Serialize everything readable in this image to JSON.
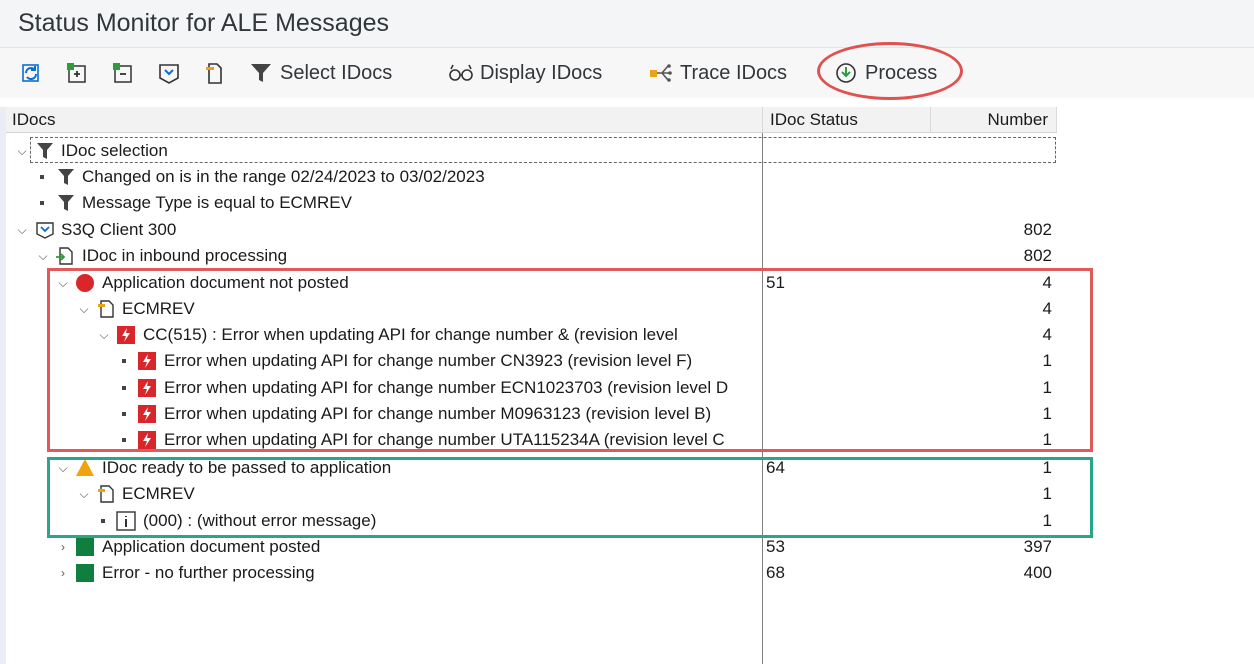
{
  "title": "Status Monitor for ALE Messages",
  "toolbar": {
    "icons": [
      "refresh-icon",
      "expand-icon",
      "collapse-icon",
      "idoc-icon",
      "message-type-icon"
    ],
    "select_label": "Select IDocs",
    "display_label": "Display IDocs",
    "trace_label": "Trace IDocs",
    "process_label": "Process"
  },
  "columns": {
    "idocs": "IDocs",
    "status": "IDoc Status",
    "number": "Number"
  },
  "tree": {
    "selection": {
      "label": "IDoc selection"
    },
    "filter1": {
      "label": "Changed on is in the range 02/24/2023 to 03/02/2023"
    },
    "filter2": {
      "label": "Message Type is equal to ECMREV"
    },
    "client": {
      "label": "S3Q Client 300",
      "number": "802"
    },
    "inbound": {
      "label": "IDoc in inbound processing",
      "number": "802"
    },
    "not_posted": {
      "label": "Application document not posted",
      "status": "51",
      "number": "4"
    },
    "ecmrev1": {
      "label": "ECMREV",
      "number": "4"
    },
    "cc515": {
      "label": "CC(515) : Error when updating API for change number & (revision level",
      "number": "4"
    },
    "err1": {
      "label": "Error when updating API for change number CN3923 (revision level F)",
      "number": "1"
    },
    "err2": {
      "label": "Error when updating API for change number ECN1023703 (revision level D",
      "number": "1"
    },
    "err3": {
      "label": "Error when updating API for change number M0963123 (revision level B)",
      "number": "1"
    },
    "err4": {
      "label": "Error when updating API for change number UTA115234A (revision level C",
      "number": "1"
    },
    "ready": {
      "label": "IDoc ready to be passed to application",
      "status": "64",
      "number": "1"
    },
    "ecmrev2": {
      "label": "ECMREV",
      "number": "1"
    },
    "info000": {
      "label": "(000) : (without error message)",
      "number": "1"
    },
    "posted": {
      "label": "Application document posted",
      "status": "53",
      "number": "397"
    },
    "no_further": {
      "label": "Error - no further processing",
      "status": "68",
      "number": "400"
    }
  },
  "colors": {
    "error_red": "#d9262a",
    "warning_yellow": "#f0a30a",
    "success_green": "#107e3e",
    "highlight_red": "#e05a5a",
    "highlight_green": "#2aa58a"
  }
}
